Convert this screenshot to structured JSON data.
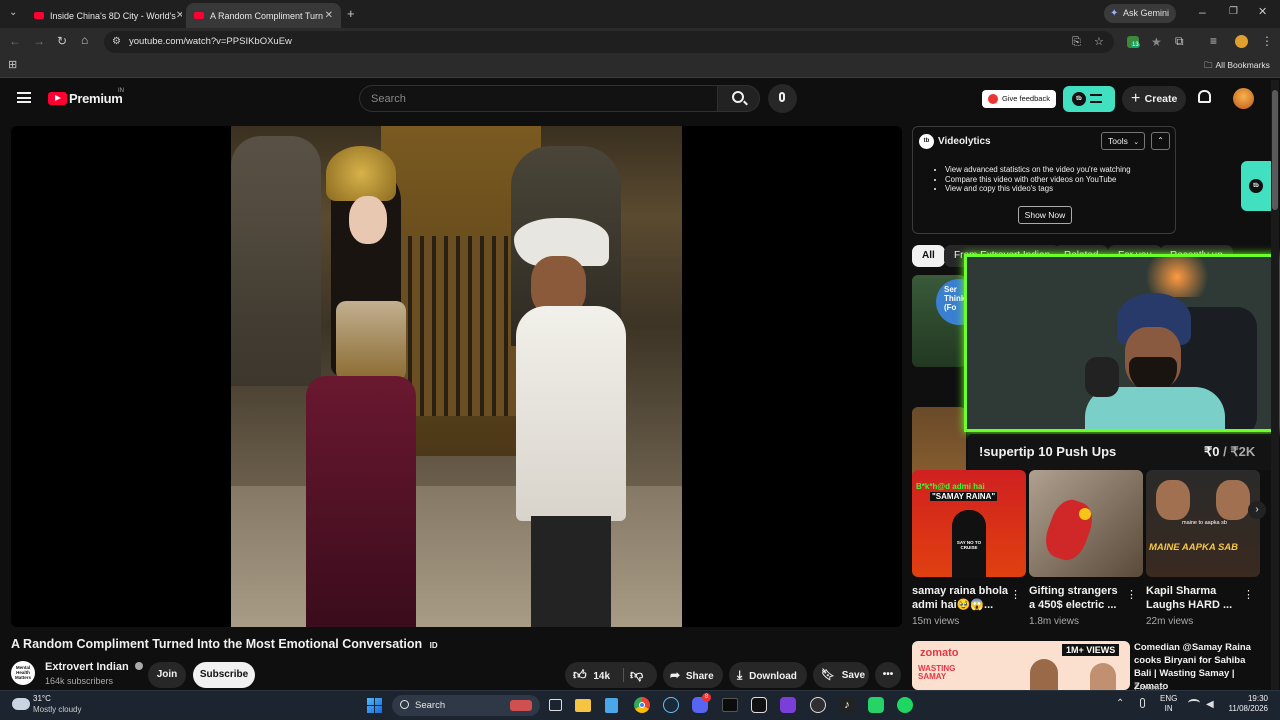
{
  "browser": {
    "tabs": [
      {
        "title": "Inside China's 8D City - World's"
      },
      {
        "title": "A Random Compliment Turn"
      }
    ],
    "url": "youtube.com/watch?v=PPSIKbOXuEw",
    "ask_gemini": "Ask Gemini",
    "all_bookmarks": "All Bookmarks",
    "extension_badge": "13"
  },
  "yt": {
    "logo": "Premium",
    "region": "IN",
    "search_placeholder": "Search",
    "give_feedback": "Give feedback",
    "create": "Create"
  },
  "video": {
    "title": "A Random Compliment Turned Into the Most Emotional Conversation",
    "title_badge": "ID",
    "channel": "Extrovert Indian",
    "subscribers": "164k subscribers",
    "channel_avatar_text": "Mental Health Matters",
    "join": "Join",
    "subscribe": "Subscribe",
    "likes": "14k",
    "share": "Share",
    "download": "Download",
    "save": "Save"
  },
  "videolytics": {
    "name": "Videolytics",
    "tools": "Tools",
    "bullets": [
      "View advanced statistics on the video you're watching",
      "Compare this video with other videos on YouTube",
      "View and copy this video's tags"
    ],
    "cta": "Show Now"
  },
  "chips": [
    "All",
    "From Extrovert Indian",
    "Related",
    "For you",
    "Recently up"
  ],
  "overlay": {
    "label": "!supertip 10 Push Ups",
    "amount": "₹0",
    "goal": "/ ₹2K"
  },
  "shorts": [
    {
      "title": "samay raina bhola admi hai🥹😱...",
      "views": "15m views",
      "thumb_top": "B*k*h@d admi hai",
      "thumb_mid": "\"SAMAY RAINA\"",
      "thumb_sign": "SAY NO TO CRUISE"
    },
    {
      "title": "Gifting strangers a 450$ electric ...",
      "views": "1.8m views"
    },
    {
      "title": "Kapil Sharma Laughs HARD ...",
      "views": "22m views",
      "thumb_caption": "MAINE AAPKA SAB",
      "thumb_small": "maine to aapka sb"
    }
  ],
  "recommended": {
    "title": "Comedian @Samay Raina cooks Biryani for Sahiba Bali | Wasting Samay | Zomato",
    "channel": "Zomato",
    "thumb_brand": "zomato",
    "thumb_views": "1M+ VIEWS",
    "thumb_show": "WASTING SAMAY"
  },
  "first_card_text": "Ser Thinki Co (Fo",
  "taskbar": {
    "temp": "31°C",
    "weather": "Mostly cloudy",
    "search": "Search",
    "lang1": "ENG",
    "lang2": "IN",
    "time": "19:30",
    "date": "11/08/2026",
    "discord_badge": "8"
  },
  "colors": {
    "yt_red": "#ff0033",
    "accent_teal": "#40e0c0",
    "overlay_green": "#6cff2a"
  }
}
